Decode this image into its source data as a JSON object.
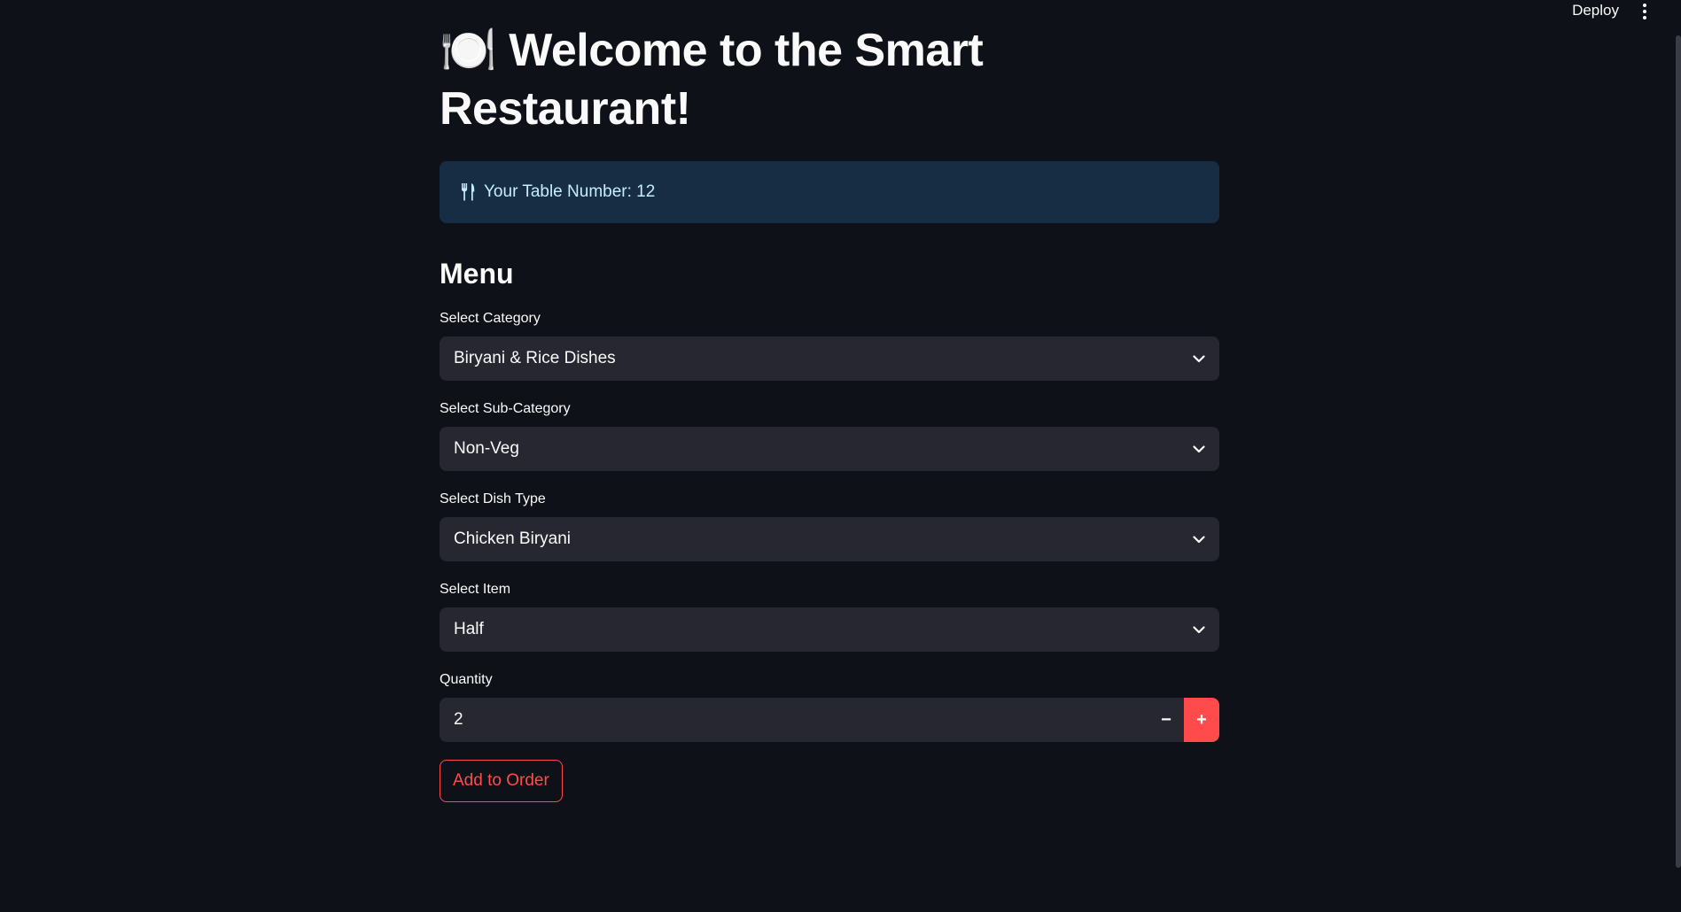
{
  "header": {
    "deploy_label": "Deploy",
    "menu_icon": "kebab-menu-icon"
  },
  "page": {
    "title_emoji": "🍽️",
    "title": "Welcome to the Smart Restaurant!",
    "info": {
      "icon": "fork-knife-icon",
      "text": "Your Table Number: 12"
    },
    "menu_heading": "Menu"
  },
  "form": {
    "category": {
      "label": "Select Category",
      "value": "Biryani & Rice Dishes"
    },
    "sub_category": {
      "label": "Select Sub-Category",
      "value": "Non-Veg"
    },
    "dish_type": {
      "label": "Select Dish Type",
      "value": "Chicken Biryani"
    },
    "item": {
      "label": "Select Item",
      "value": "Half"
    },
    "quantity": {
      "label": "Quantity",
      "value": "2",
      "minus": "−",
      "plus": "+"
    },
    "add_button": "Add to Order"
  },
  "colors": {
    "background": "#0e1117",
    "info_bg": "#172d43",
    "info_text": "#c7ebff",
    "input_bg": "#262730",
    "accent": "#ff4b4b"
  }
}
